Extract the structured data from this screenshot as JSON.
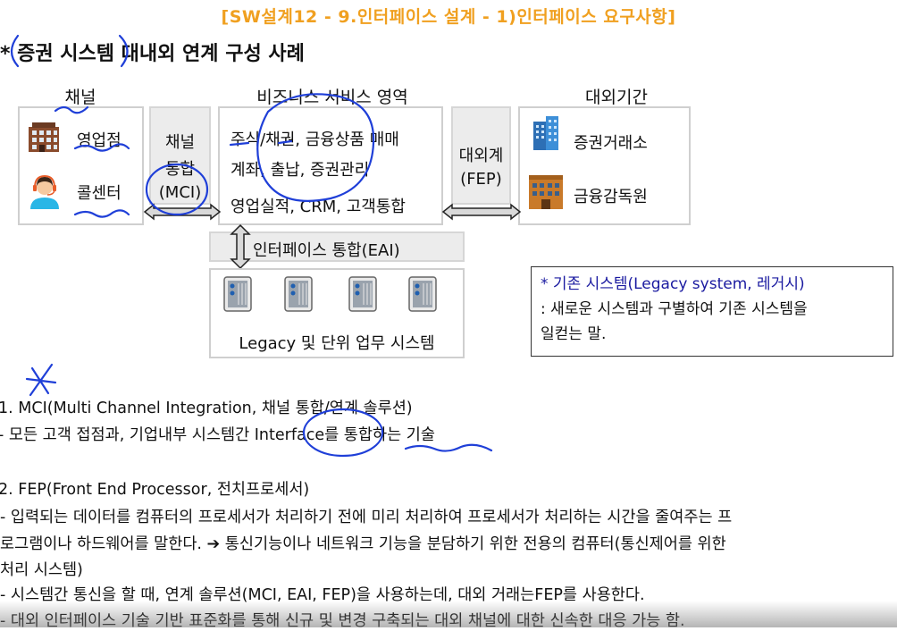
{
  "header": "[SW설계12 - 9.인터페이스 설계 - 1)인터페이스 요구사항]",
  "title": "* 증권 시스템 대내외 연계 구성 사례",
  "columns": {
    "channel": "채널",
    "business": "비즈니스 서비스 영역",
    "external": "대외기간"
  },
  "channel_box": {
    "item1": "영업점",
    "item2": "콜센터",
    "item1_icon": "building-icon",
    "item2_icon": "headset-agent-icon"
  },
  "mci_box": {
    "line1": "채널",
    "line2": "통합",
    "line3": "(MCI)"
  },
  "business_box": {
    "line1": "주식/채권, 금융상품 매매",
    "line2": "계좌, 출납, 증권관리",
    "line3": "영업실적, CRM, 고객통합"
  },
  "fep_box": {
    "line1": "대외계",
    "line2": "(FEP)"
  },
  "external_box": {
    "item1": "증권거래소",
    "item2": "금융감독원",
    "item1_icon": "office-tower-icon",
    "item2_icon": "building-icon"
  },
  "eai_label": "인터페이스 통합(EAI)",
  "legacy_box": {
    "label": "Legacy 및 단위 업무 시스템",
    "icon": "server-icon"
  },
  "note": {
    "line1": "* 기존 시스템(Legacy system, 레거시)",
    "line2": ": 새로운 시스템과 구별하여 기존 시스템을",
    "line3": "일컫는 말."
  },
  "section1": {
    "heading": "1. MCI(Multi Channel Integration, 채널 통합/연계 솔루션)",
    "body": "- 모든 고객 접점과, 기업내부 시스템간 Interface를 통합하는 기술"
  },
  "section2": {
    "heading": "2. FEP(Front End Processor, 전치프로세서)",
    "line1": "- 입력되는 데이터를 컴퓨터의 프로세서가 처리하기 전에 미리 처리하여 프로세서가 처리하는 시간을 줄여주는 프",
    "line2": "로그램이나 하드웨어를 말한다. ➔ 통신기능이나 네트워크 기능을 분담하기 위한 전용의 컴퓨터(통신제어를 위한",
    "line3": "처리 시스템)",
    "line4": "- 시스템간 통신을 할 때, 연계 솔루션(MCI, EAI, FEP)을 사용하는데, 대외 거래는FEP를 사용한다.",
    "line5": "- 대외 인터페이스 기술 기반 표준화를 통해 신규 및 변경 구축되는 대외 채널에 대한 신속한 대응 가능 함."
  },
  "colors": {
    "header": "#f0a020",
    "accent_blue": "#1a2ea8",
    "annotation_ink": "#1f3fd8"
  }
}
